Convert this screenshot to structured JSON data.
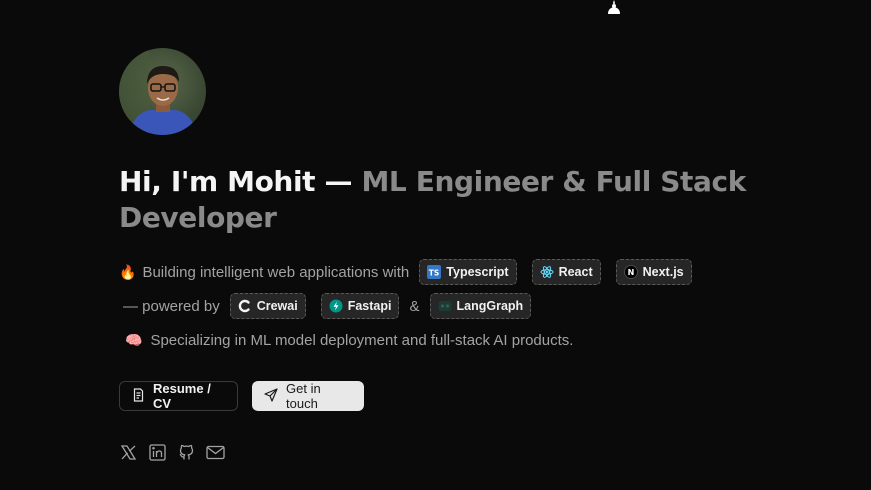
{
  "hero": {
    "name_text": "Hi, I'm Mohit —",
    "role_text": "ML Engineer & Full Stack Developer",
    "line1_emoji": "🔥",
    "line1_text": "Building intelligent web applications with",
    "line2_text": "— powered by",
    "amp": "&",
    "line3_emoji": "🧠",
    "line3_text": "Specializing in ML model deployment and full-stack AI products."
  },
  "tech_pills": {
    "typescript": "Typescript",
    "react": "React",
    "nextjs": "Next.js",
    "crewai": "Crewai",
    "fastapi": "Fastapi",
    "langgraph": "LangGraph"
  },
  "buttons": {
    "resume": "Resume / CV",
    "contact": "Get in touch"
  },
  "socials": [
    "x-icon",
    "linkedin-icon",
    "github-icon",
    "mail-icon"
  ],
  "colors": {
    "background": "#0a0a0a",
    "heading": "#f5f5f5",
    "muted": "#8a8a8a",
    "pill_bg": "#262626"
  }
}
